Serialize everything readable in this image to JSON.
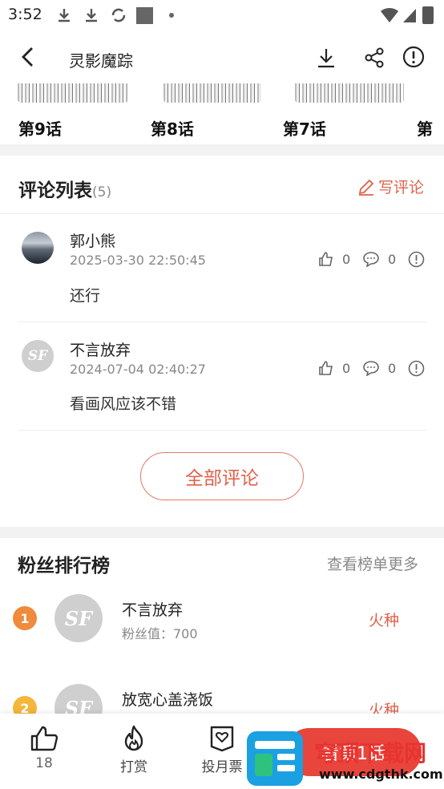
{
  "status_bar": {
    "time": "3:52"
  },
  "nav": {
    "title": "灵影魔踪"
  },
  "chapters": [
    "第9话",
    "第8话",
    "第7话",
    "第"
  ],
  "comments": {
    "heading": "评论列表",
    "count": "(5)",
    "write_label": "写评论",
    "items": [
      {
        "user": "郭小熊",
        "time": "2025-03-30 22:50:45",
        "text": "还行",
        "likes": "0",
        "replies": "0"
      },
      {
        "user": "不言放弃",
        "time": "2024-07-04 02:40:27",
        "text": "看画风应该不错",
        "likes": "0",
        "replies": "0"
      }
    ],
    "all_label": "全部评论"
  },
  "fans": {
    "heading": "粉丝排行榜",
    "more": "查看榜单更多",
    "items": [
      {
        "rank": "1",
        "name": "不言放弃",
        "value": "粉丝值：700",
        "tag": "火种"
      },
      {
        "rank": "2",
        "name": "放宽心盖浇饭",
        "tag": "火种"
      }
    ]
  },
  "bottom": {
    "like_count": "18",
    "reward": "打赏",
    "monthly_ticket": "投月票",
    "read_label": "看第1话"
  },
  "watermark": {
    "text_cn": "穹顶下载网",
    "url": "www.cdgthk.com"
  },
  "colors": {
    "accent": "#e0614a",
    "rank1": "#f08a3c",
    "rank2": "#f3b73b"
  },
  "icons": [
    "back-arrow-icon",
    "download-icon",
    "share-icon",
    "report-icon",
    "edit-icon",
    "thumb-up-icon",
    "comment-icon",
    "flame-icon",
    "heart-ticket-icon"
  ]
}
